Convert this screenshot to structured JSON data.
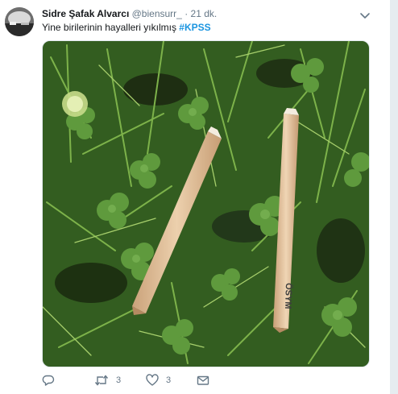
{
  "tweet": {
    "author_name": "Sidre Şafak Alvarcı",
    "handle": "@biensurr_",
    "separator": "·",
    "time": "21 dk.",
    "text": "Yine birilerinin hayalleri yıkılmış",
    "hashtag": "#KPSS",
    "media": {
      "pencil_brand_text": "ÖSYM",
      "colors": {
        "grass": "#2f5a1e",
        "pencil": "#e3c39a",
        "lead": "#c8a98a"
      }
    },
    "actions": {
      "reply_count": "",
      "retweet_count": "3",
      "like_count": "3"
    }
  },
  "colors": {
    "link": "#1b95e0",
    "secondary_text": "#657786",
    "icon": "#657786"
  }
}
